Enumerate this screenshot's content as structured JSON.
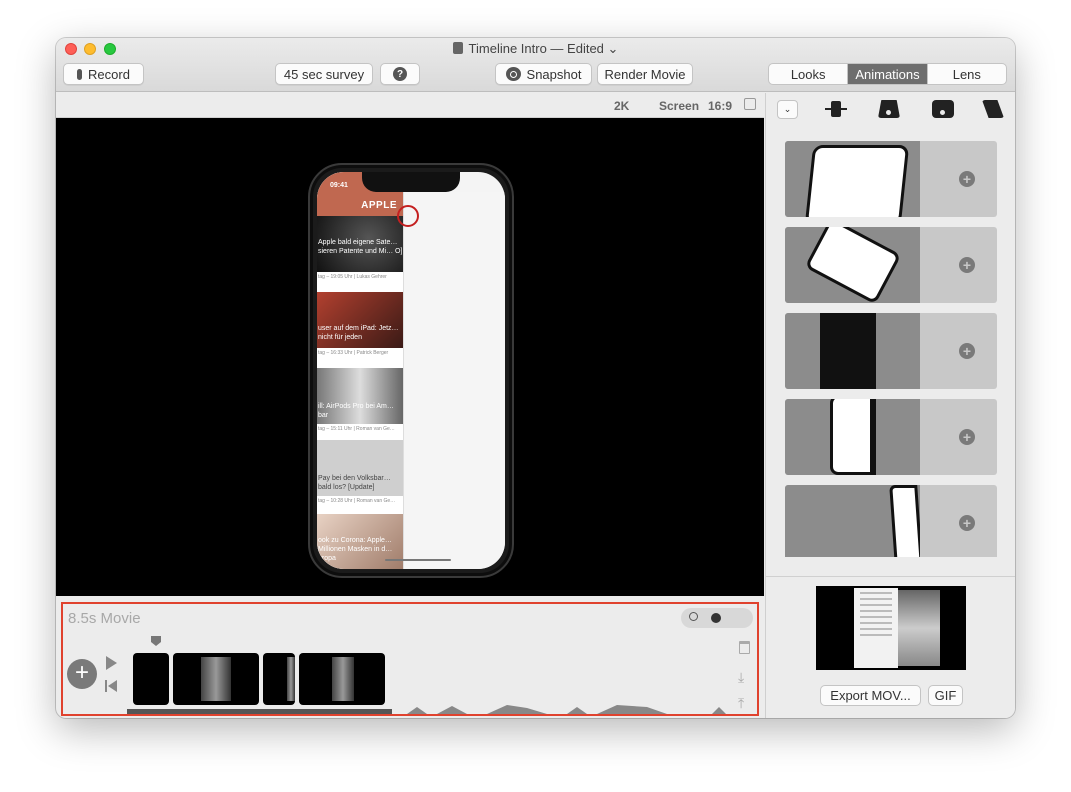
{
  "window": {
    "title": "Timeline Intro — Edited",
    "title_chevron": "⌄"
  },
  "toolbar": {
    "record_label": "Record",
    "survey_label": "45 sec survey",
    "help_label": "?",
    "snapshot_label": "Snapshot",
    "render_label": "Render Movie",
    "tabs": [
      {
        "label": "Looks",
        "active": false
      },
      {
        "label": "Animations",
        "active": true
      },
      {
        "label": "Lens",
        "active": false
      }
    ]
  },
  "canvas_header": {
    "resolution": "2K",
    "screen": "Screen",
    "ratio": "16:9"
  },
  "phone": {
    "time": "09:41",
    "app_title": "APPLE",
    "back_arrow": "←",
    "articles": [
      {
        "title": "Apple bald eigene Sate… sieren Patente und Mi… O]",
        "meta": "tag – 19:05 Uhr | Lukas Gehrer"
      },
      {
        "title": "user auf dem iPad: Jetz… nicht für jeden",
        "meta": "tag – 16:33 Uhr | Patrick Berger"
      },
      {
        "title": "ill: AirPods Pro bei Am… bar",
        "meta": "tag – 15:11 Uhr | Roman van Ge…"
      },
      {
        "title": "Pay bei den Volksbar… bald los? [Update]",
        "meta": "tag – 10:28 Uhr | Roman van Ge…"
      },
      {
        "title": "ook zu Corona: Apple… Millionen Masken in d… uropa",
        "meta": ""
      }
    ]
  },
  "timeline": {
    "movie_label": "8.5s Movie",
    "add_symbol": "+",
    "down_symbol": "⤓",
    "up_symbol": "⤒"
  },
  "right_panel": {
    "dropdown_symbol": "⌄",
    "add_symbol": "+",
    "export_label": "Export MOV...",
    "gif_label": "GIF"
  },
  "icons": {
    "record": "mic-icon",
    "help": "help-icon",
    "snapshot": "camera-icon",
    "play": "play-icon",
    "rewind": "rewind-icon",
    "trash": "trash-icon",
    "zoom": "magnifier-icon",
    "rotate": "rotate-icon"
  },
  "colors": {
    "accent_active_tab": "#6e6e6e",
    "timeline_border": "#e0422e",
    "app_header": "#c06850",
    "record_ring": "#c42020"
  }
}
